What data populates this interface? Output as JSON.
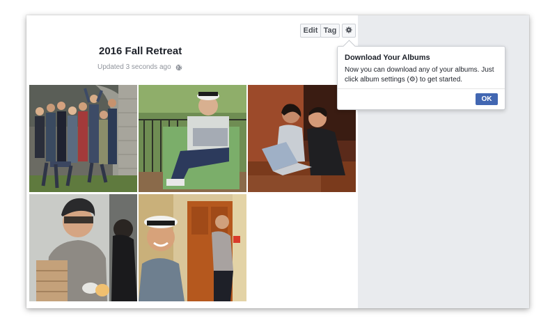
{
  "album": {
    "title": "2016 Fall Retreat",
    "updated": "Updated 3 seconds ago",
    "privacy_icon": "globe-icon"
  },
  "toolbar": {
    "edit_label": "Edit",
    "tag_label": "Tag",
    "settings_icon": "gear-icon"
  },
  "popover": {
    "title": "Download Your Albums",
    "body": "Now you can download any of your albums. Just click album settings (⚙) to get started.",
    "ok_label": "OK"
  },
  "photos": [
    {
      "subject": "group-photo"
    },
    {
      "subject": "man-in-chair"
    },
    {
      "subject": "two-at-laptop"
    },
    {
      "subject": "man-with-beanie"
    },
    {
      "subject": "smiling-man-in-hat"
    }
  ],
  "colors": {
    "accent": "#4267b2",
    "page_bg": "#e9ebee"
  }
}
